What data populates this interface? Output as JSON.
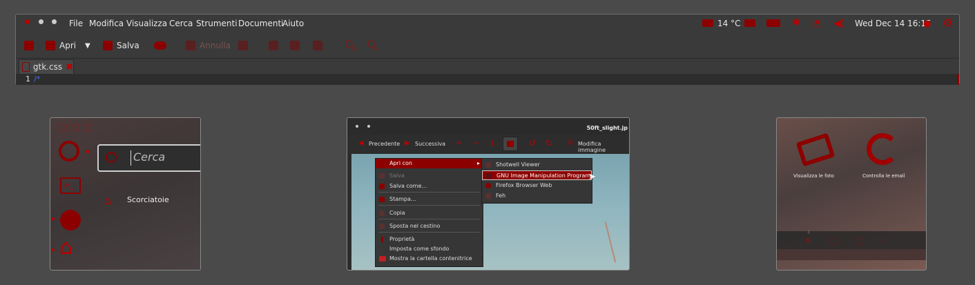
{
  "editor": {
    "menu": [
      "File",
      "Modifica",
      "Visualizza",
      "Cerca",
      "Strumenti",
      "Documenti",
      "Aiuto"
    ],
    "tray": {
      "temperature": "14 °C",
      "datetime": "Wed Dec 14 16:15"
    },
    "toolbar": {
      "open_label": "Apri",
      "save_label": "Salva",
      "undo_label": "Annulla"
    },
    "tab": {
      "filename": "gtk.css"
    },
    "content": {
      "line_number": "1",
      "text": "/*"
    }
  },
  "launcher": {
    "search_placeholder": "Cerca",
    "shortcuts_label": "Scorciatoie"
  },
  "viewer": {
    "title": "50ft_slight.jp",
    "prev_label": "Precedente",
    "next_label": "Successiva",
    "edit_label": "Modifica immagine",
    "context_menu": [
      "Apri con",
      "Salva",
      "Salva come...",
      "Stampa...",
      "Copia",
      "Sposta nel cestino",
      "Proprietà",
      "Imposta come sfondo",
      "Mostra la cartella contenitrice"
    ],
    "submenu": [
      "Shotwell Viewer",
      "GNU Image Manipulation Program",
      "Firefox Browser Web",
      "Feh"
    ]
  },
  "dash": {
    "item1": "Visualizza le foto",
    "item2": "Controlla le email"
  }
}
